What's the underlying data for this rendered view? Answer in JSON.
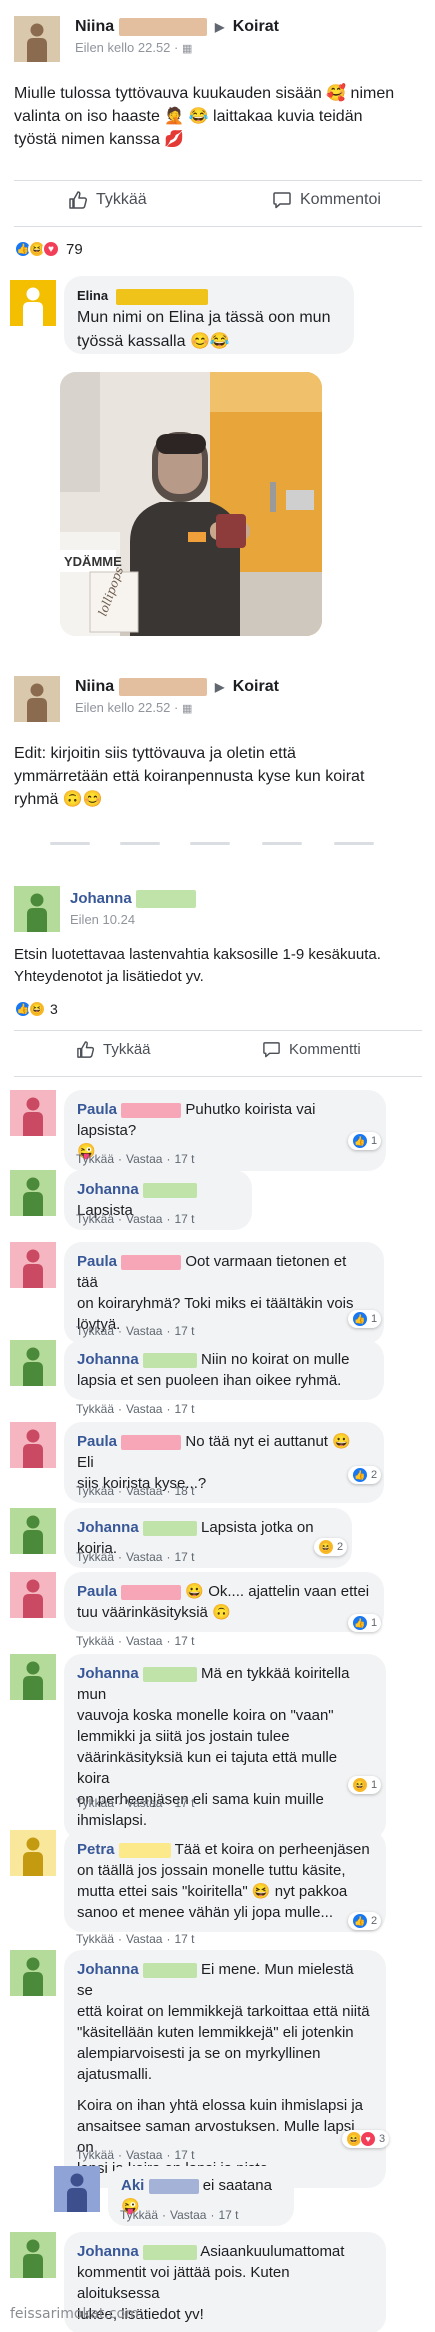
{
  "post1": {
    "author_first": "Niina",
    "group": "Koirat",
    "time": "Eilen kello 22.52 · ",
    "text_lines": [
      "Miulle tulossa tyttövauva kuukauden sisään 🥰 nimen",
      "valinta on iso haaste 🤦 😂 laittakaa kuvia teidän",
      "työstä nimen kanssa 💋"
    ],
    "like_label": "Tykkää",
    "comment_label": "Kommentoi",
    "reaction_count": "79"
  },
  "elina_comment": {
    "name": "Elina",
    "text_lines": [
      "Mun nimi on Elina ja tässä oon mun",
      "työssä kassalla 😊😂"
    ],
    "photo_sign_text": "YDÄMME",
    "photo_product": "lollipops"
  },
  "post2": {
    "author_first": "Niina",
    "group": "Koirat",
    "time": "Eilen kello 22.52 · ",
    "text_lines": [
      "Edit: kirjoitin siis tyttövauva ja oletin että",
      "ymmärretään että koiranpennusta kyse kun koirat",
      "ryhmä 🙃😊"
    ]
  },
  "post3": {
    "author_first": "Johanna",
    "time": "Eilen 10.24",
    "text_lines": [
      "Etsin luotettavaa lastenvahtia kaksosille 1-9 kesäkuuta.",
      "Yhteydenotot ja lisätiedot yv."
    ],
    "reaction_count": "3",
    "like_label": "Tykkää",
    "comment_label": "Kommentti"
  },
  "comment_actions": {
    "like": "Tykkää",
    "reply": "Vastaa",
    "sep": "·"
  },
  "comments": [
    {
      "name": "Paula",
      "lines": [
        "Puhutko koirista vai lapsista?",
        "😜"
      ],
      "time": "17 t",
      "react": "1"
    },
    {
      "name": "Johanna",
      "lines": [
        "Lapsista"
      ],
      "time": "17 t",
      "react": ""
    },
    {
      "name": "Paula",
      "lines": [
        "Oot varmaan tietonen et tää",
        "on koiraryhmä? Toki miks ei tääItäkin vois",
        "löytyä."
      ],
      "time": "17 t",
      "react": "1"
    },
    {
      "name": "Johanna",
      "lines": [
        "Niin no koirat on mulle",
        "lapsia et sen puoleen ihan oikee ryhmä."
      ],
      "time": "17 t",
      "react": ""
    },
    {
      "name": "Paula",
      "lines": [
        "No tää nyt ei auttanut 😀 Eli",
        "siis koirista kyse...?"
      ],
      "time": "18 t",
      "react": "2"
    },
    {
      "name": "Johanna",
      "lines": [
        "Lapsista jotka on koiria."
      ],
      "time": "17 t",
      "react": "2"
    },
    {
      "name": "Paula",
      "lines": [
        "😀 Ok.... ajattelin vaan ettei",
        "tuu väärinkäsityksiä 🙃"
      ],
      "time": "17 t",
      "react": "1"
    },
    {
      "name": "Johanna",
      "lines": [
        "Mä en tykkää koiritella mun",
        "vauvoja koska monelle koira on \"vaan\"",
        "lemmikki ja siitä jos jostain tulee",
        "väärinkäsityksiä kun ei tajuta että mulle koira",
        "on perheenjäsen eli sama kuin muille",
        "ihmislapsi."
      ],
      "time": "17 t",
      "react": "1"
    },
    {
      "name": "Petra",
      "lines": [
        "Tää et koira on perheenjäsen",
        "on täällä jos jossain monelle tuttu käsite,",
        "mutta ettei sais \"koiritella\" 😆 nyt pakkoa",
        "sanoo et menee vähän yli jopa mulle..."
      ],
      "time": "17 t",
      "react": "2"
    },
    {
      "name": "Johanna",
      "lines": [
        "Ei mene. Mun mielestä se",
        "että koirat on lemmikkejä tarkoittaa että niitä",
        "\"käsitellään kuten lemmikkejä\" eli jotenkin",
        "alempiarvoisesti ja se on myrkyllinen",
        "ajatusmalli.",
        "",
        "Koira on ihan yhtä elossa kuin ihmislapsi ja",
        "ansaitsee saman arvostuksen. Mulle lapsi on",
        "lapsi ja koira on lapsi ja piste."
      ],
      "time": "17 t",
      "react": "3"
    },
    {
      "name": "Aki",
      "lines": [
        "ei saatana 😜"
      ],
      "time": "17 t",
      "react": ""
    },
    {
      "name": "Johanna",
      "lines": [
        "Asiaankuulumattomat",
        "kommentit voi jättää pois. Kuten aloituksessa",
        "lukee, lisätiedot yv!"
      ],
      "time": "",
      "react": ""
    }
  ],
  "watermark": "feissarimokat.com"
}
